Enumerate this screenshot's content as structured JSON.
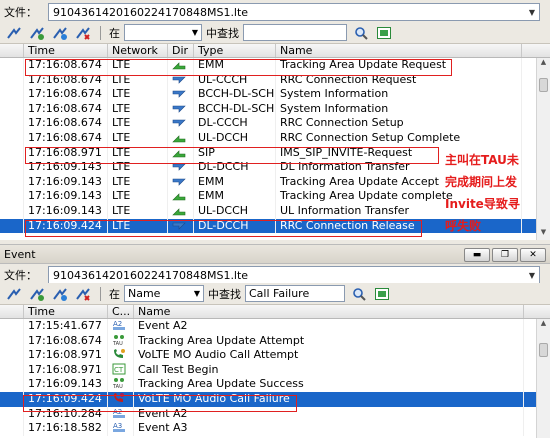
{
  "top": {
    "file_label": "文件：",
    "file_value": "9104361420160224170848MS1.lte",
    "toolbar": {
      "in_label": "在",
      "in_value": "",
      "find_label": "中查找",
      "find_value": ""
    },
    "columns": [
      "Time",
      "Network",
      "Dir",
      "Type",
      "Name"
    ],
    "rows": [
      {
        "time": "17:16:08.674",
        "network": "LTE",
        "dir": "up-green",
        "type": "EMM",
        "name": "Tracking Area Update Request"
      },
      {
        "time": "17:16:08.674",
        "network": "LTE",
        "dir": "down-blue",
        "type": "UL-CCCH",
        "name": "RRC Connection Request"
      },
      {
        "time": "17:16:08.674",
        "network": "LTE",
        "dir": "down-blue",
        "type": "BCCH-DL-SCH",
        "name": "System Information"
      },
      {
        "time": "17:16:08.674",
        "network": "LTE",
        "dir": "down-blue",
        "type": "BCCH-DL-SCH",
        "name": "System Information"
      },
      {
        "time": "17:16:08.674",
        "network": "LTE",
        "dir": "down-blue",
        "type": "DL-CCCH",
        "name": "RRC Connection Setup"
      },
      {
        "time": "17:16:08.674",
        "network": "LTE",
        "dir": "up-green",
        "type": "UL-DCCH",
        "name": "RRC Connection Setup Complete"
      },
      {
        "time": "17:16:08.971",
        "network": "LTE",
        "dir": "up-green",
        "type": "SIP",
        "name": "IMS_SIP_INVITE-Request"
      },
      {
        "time": "17:16:09.143",
        "network": "LTE",
        "dir": "down-blue",
        "type": "DL-DCCH",
        "name": "DL Information Transfer"
      },
      {
        "time": "17:16:09.143",
        "network": "LTE",
        "dir": "down-blue",
        "type": "EMM",
        "name": "Tracking Area Update Accept"
      },
      {
        "time": "17:16:09.143",
        "network": "LTE",
        "dir": "up-green",
        "type": "EMM",
        "name": "Tracking Area Update complete"
      },
      {
        "time": "17:16:09.143",
        "network": "LTE",
        "dir": "up-green",
        "type": "UL-DCCH",
        "name": "UL Information Transfer"
      },
      {
        "time": "17:16:09.424",
        "network": "LTE",
        "dir": "down-blue",
        "type": "DL-DCCH",
        "name": "RRC Connection Release"
      }
    ],
    "annotation": [
      "主叫在TAU未",
      "完成期间上发",
      "Invite导致寻",
      "呼失败"
    ]
  },
  "event": {
    "title": "Event",
    "file_label": "文件：",
    "file_value": "9104361420160224170848MS1.lte",
    "toolbar": {
      "in_label": "在",
      "in_value": "Name",
      "find_label": "中查找",
      "find_value": "Call Failure"
    },
    "columns": [
      "Time",
      "C...",
      "Name"
    ],
    "rows": [
      {
        "time": "17:15:41.677",
        "icon": "A2",
        "name": "Event A2"
      },
      {
        "time": "17:16:08.674",
        "icon": "TAU",
        "name": "Tracking Area Update Attempt"
      },
      {
        "time": "17:16:08.971",
        "icon": "call",
        "name": "VoLTE MO Audio Call Attempt"
      },
      {
        "time": "17:16:08.971",
        "icon": "CT",
        "name": "Call Test Begin"
      },
      {
        "time": "17:16:09.143",
        "icon": "TAU-ok",
        "name": "Tracking Area Update Success"
      },
      {
        "time": "17:16:09.424",
        "icon": "call-fail",
        "name": "VoLTE MO Audio Call Failure"
      },
      {
        "time": "17:16:10.284",
        "icon": "A2",
        "name": "Event A2"
      },
      {
        "time": "17:16:18.582",
        "icon": "A3",
        "name": "Event A3"
      }
    ]
  },
  "colors": {
    "selection": "#1a66c9",
    "highlight_box": "#e02020",
    "annotation": "#e51c1c"
  }
}
